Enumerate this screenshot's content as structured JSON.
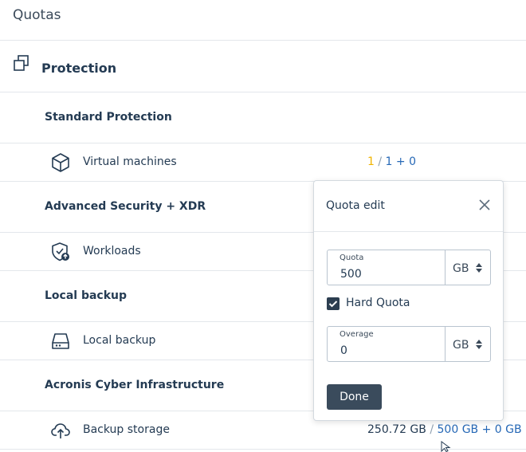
{
  "page": {
    "title": "Quotas"
  },
  "section": {
    "title": "Protection",
    "icon": "protection-icon"
  },
  "groups": [
    {
      "title": "Standard Protection",
      "item": {
        "label": "Virtual machines",
        "icon": "cube-icon",
        "used": "1",
        "limit": "1 + 0"
      }
    },
    {
      "title": "Advanced Security + XDR",
      "item": {
        "label": "Workloads",
        "icon": "shield-check-icon"
      }
    },
    {
      "title": "Local backup",
      "item": {
        "label": "Local backup",
        "icon": "hard-drive-icon"
      }
    },
    {
      "title": "Acronis Cyber Infrastructure",
      "item": {
        "label": "Backup storage",
        "icon": "cloud-upload-icon",
        "used": "250.72 GB",
        "limit": "500 GB + 0 GB"
      }
    }
  ],
  "quota_edit": {
    "title": "Quota edit",
    "quota": {
      "label": "Quota",
      "value": "500",
      "unit": "GB"
    },
    "hard_quota": {
      "label": "Hard Quota",
      "checked": true
    },
    "overage": {
      "label": "Overage",
      "value": "0",
      "unit": "GB"
    },
    "done_label": "Done"
  },
  "colors": {
    "accent": "#2668b6",
    "warning": "#f0b400",
    "button": "#3a4b5c"
  }
}
